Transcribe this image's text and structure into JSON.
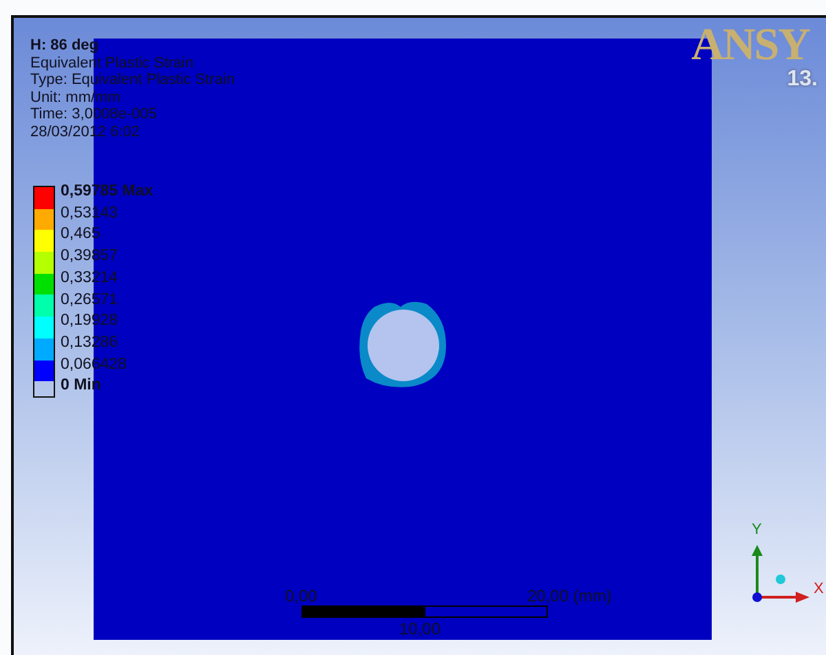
{
  "header": {
    "title": "H: 86 deg",
    "lines": [
      "Equivalent Plastic Strain",
      "Type: Equivalent Plastic Strain",
      "Unit: mm/mm",
      "Time: 3,0008e-005",
      "28/03/2012 6:02"
    ]
  },
  "legend": {
    "bands": [
      {
        "color": "#ff0000"
      },
      {
        "color": "#ffaa00"
      },
      {
        "color": "#ffff00"
      },
      {
        "color": "#b4ff00"
      },
      {
        "color": "#00e000"
      },
      {
        "color": "#00ffaa"
      },
      {
        "color": "#00ffff"
      },
      {
        "color": "#00aaff"
      },
      {
        "color": "#0000ff"
      }
    ],
    "labels": [
      {
        "text": "0,59785 Max",
        "kind": "extreme"
      },
      {
        "text": "0,53143",
        "kind": "value"
      },
      {
        "text": "0,465",
        "kind": "value"
      },
      {
        "text": "0,39857",
        "kind": "value"
      },
      {
        "text": "0,33214",
        "kind": "value"
      },
      {
        "text": "0,26571",
        "kind": "value"
      },
      {
        "text": "0,19928",
        "kind": "value"
      },
      {
        "text": "0,13286",
        "kind": "value"
      },
      {
        "text": "0,066428",
        "kind": "value"
      },
      {
        "text": "0 Min",
        "kind": "extreme"
      }
    ]
  },
  "logo": {
    "text": "ANSY",
    "version": "13."
  },
  "scale": {
    "start": "0,00",
    "end": "20,00 (mm)",
    "middle": "10,00"
  },
  "triad": {
    "x": "X",
    "y": "Y"
  }
}
